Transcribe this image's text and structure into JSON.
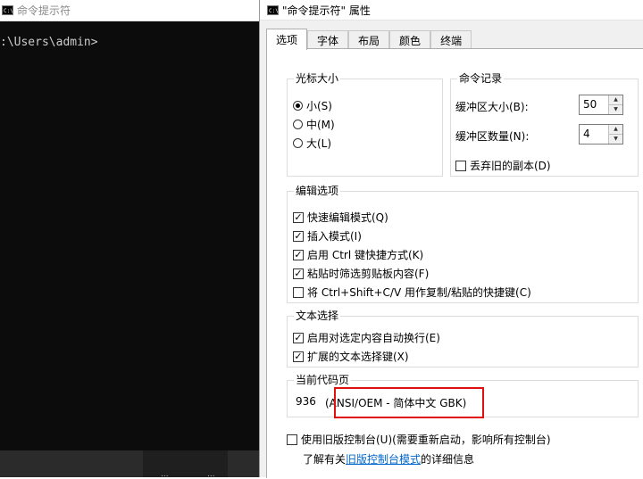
{
  "console": {
    "title": "命令提示符",
    "prompt_text": ":\\Users\\admin>",
    "taskbar_texts": [
      "...",
      "..."
    ]
  },
  "dialog": {
    "title": "\"命令提示符\" 属性",
    "tabs": [
      {
        "label": "选项",
        "active": true
      },
      {
        "label": "字体",
        "active": false
      },
      {
        "label": "布局",
        "active": false
      },
      {
        "label": "颜色",
        "active": false
      },
      {
        "label": "终端",
        "active": false
      }
    ],
    "cursor_size": {
      "label": "光标大小",
      "options": [
        {
          "label": "小(S)",
          "selected": true
        },
        {
          "label": "中(M)",
          "selected": false
        },
        {
          "label": "大(L)",
          "selected": false
        }
      ]
    },
    "command_history": {
      "label": "命令记录",
      "buffer_size_label": "缓冲区大小(B):",
      "buffer_size_value": "50",
      "buffer_count_label": "缓冲区数量(N):",
      "buffer_count_value": "4",
      "discard_label": "丢弃旧的副本(D)",
      "discard_checked": false
    },
    "edit_options": {
      "label": "编辑选项",
      "items": [
        {
          "label": "快速编辑模式(Q)",
          "checked": true
        },
        {
          "label": "插入模式(I)",
          "checked": true
        },
        {
          "label": "启用 Ctrl 键快捷方式(K)",
          "checked": true
        },
        {
          "label": "粘贴时筛选剪贴板内容(F)",
          "checked": true
        },
        {
          "label": "将 Ctrl+Shift+C/V 用作复制/粘贴的快捷键(C)",
          "checked": false
        }
      ]
    },
    "text_selection": {
      "label": "文本选择",
      "items": [
        {
          "label": "启用对选定内容自动换行(E)",
          "checked": true
        },
        {
          "label": "扩展的文本选择键(X)",
          "checked": true
        }
      ]
    },
    "code_page": {
      "label": "当前代码页",
      "number": "936",
      "description": "(ANSI/OEM - 简体中文 GBK)"
    },
    "legacy": {
      "label": "使用旧版控制台(U)(需要重新启动，影响所有控制台)",
      "checked": false,
      "info_prefix": "了解有关",
      "info_link": "旧版控制台模式",
      "info_suffix": "的详细信息"
    }
  },
  "colors": {
    "highlight": "#e01010",
    "link": "#0066cc",
    "console_bg": "#0c0c0c"
  }
}
